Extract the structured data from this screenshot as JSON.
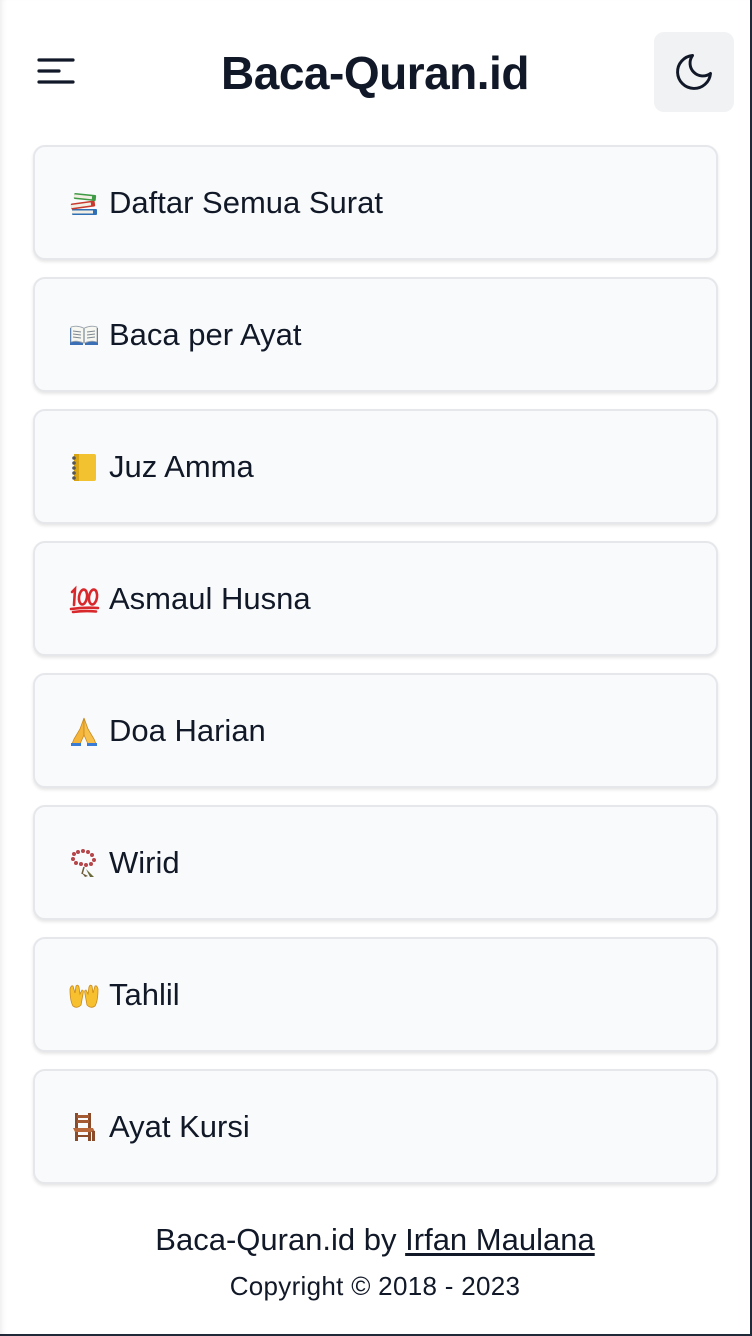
{
  "header": {
    "title": "Baca-Quran.id",
    "menu_icon": "hamburger-menu-icon",
    "theme_icon": "moon-icon"
  },
  "menu": {
    "items": [
      {
        "label": "Daftar Semua Surat",
        "icon": "books-icon"
      },
      {
        "label": "Baca per Ayat",
        "icon": "open-book-icon"
      },
      {
        "label": "Juz Amma",
        "icon": "notebook-icon"
      },
      {
        "label": "Asmaul Husna",
        "icon": "hundred-points-icon"
      },
      {
        "label": "Doa Harian",
        "icon": "folded-hands-icon"
      },
      {
        "label": "Wirid",
        "icon": "prayer-beads-icon"
      },
      {
        "label": "Tahlil",
        "icon": "palms-up-icon"
      },
      {
        "label": "Ayat Kursi",
        "icon": "chair-icon"
      }
    ]
  },
  "footer": {
    "credit_prefix": "Baca-Quran.id by ",
    "author": "Irfan Maulana",
    "copyright": "Copyright © 2018 - 2023"
  },
  "colors": {
    "text": "#111827",
    "card_bg": "#f9fafb",
    "card_border": "#e5e7eb",
    "theme_button_bg": "#f1f2f4"
  }
}
